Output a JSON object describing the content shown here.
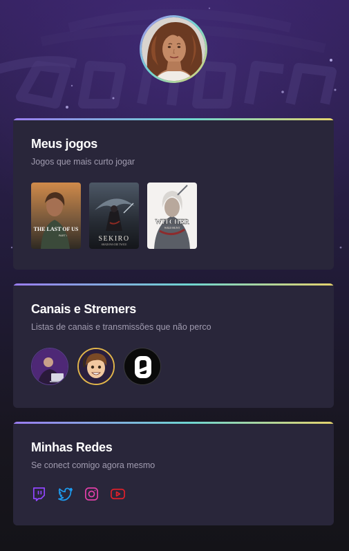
{
  "profile": {
    "avatar_alt": "Foto de perfil"
  },
  "background": {
    "watermark": "ROCKETSEAT"
  },
  "games_card": {
    "title": "Meus jogos",
    "subtitle": "Jogos que mais curto jogar",
    "games": [
      {
        "name": "The Last of Us Part I",
        "cover_title": "THE LAST OF US",
        "cover_sub": "PART I"
      },
      {
        "name": "Sekiro: Shadows Die Twice",
        "cover_title": "SEKIRO",
        "cover_sub": "SHADOWS DIE TWICE"
      },
      {
        "name": "The Witcher 3: Wild Hunt",
        "cover_title": "WITCHER",
        "cover_sub": "WILD HUNT"
      }
    ]
  },
  "channels_card": {
    "title": "Canais e Stremers",
    "subtitle": "Listas de canais e transmissões que não perco",
    "channels": [
      {
        "name": "channel-1"
      },
      {
        "name": "channel-2"
      },
      {
        "name": "channel-3"
      }
    ]
  },
  "socials_card": {
    "title": "Minhas Redes",
    "subtitle": "Se conect comigo agora mesmo",
    "networks": [
      {
        "name": "Twitch",
        "icon": "twitch-icon",
        "color": "#9146ff"
      },
      {
        "name": "Twitter",
        "icon": "twitter-icon",
        "color": "#1d9bf0"
      },
      {
        "name": "Instagram",
        "icon": "instagram-icon",
        "color": "#e1306c"
      },
      {
        "name": "YouTube",
        "icon": "youtube-icon",
        "color": "#ff0000"
      }
    ]
  },
  "colors": {
    "card_bg": "#29263a",
    "gradient_start": "#9a7cf0",
    "gradient_mid": "#6fd6d1",
    "gradient_end": "#e5d46d",
    "subtitle_text": "#a19cb0"
  }
}
